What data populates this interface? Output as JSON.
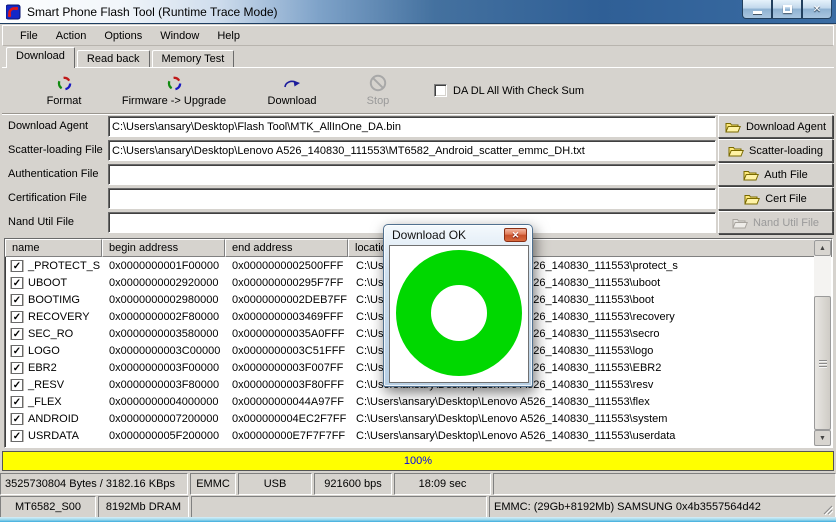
{
  "colors": {
    "ring_green": "#00d800",
    "progress_yellow": "#ffff00",
    "progress_text_blue": "#0000ee",
    "titlebar_blue": "#3a6ca3"
  },
  "window": {
    "title": "Smart Phone Flash Tool (Runtime Trace Mode)"
  },
  "menu": {
    "items": [
      "File",
      "Action",
      "Options",
      "Window",
      "Help"
    ]
  },
  "tabs": {
    "download": "Download",
    "readback": "Read back",
    "memorytest": "Memory Test"
  },
  "toolbar": {
    "format": "Format",
    "firmware_upgrade": "Firmware -> Upgrade",
    "download": "Download",
    "stop": "Stop",
    "da_dl_checksum": "DA DL All With Check Sum"
  },
  "files": {
    "rows": [
      {
        "label": "Download Agent",
        "value": "C:\\Users\\ansary\\Desktop\\Flash Tool\\MTK_AllInOne_DA.bin",
        "button": "Download Agent"
      },
      {
        "label": "Scatter-loading File",
        "value": "C:\\Users\\ansary\\Desktop\\Lenovo A526_140830_111553\\MT6582_Android_scatter_emmc_DH.txt",
        "button": "Scatter-loading"
      },
      {
        "label": "Authentication File",
        "value": "",
        "button": "Auth File"
      },
      {
        "label": "Certification File",
        "value": "",
        "button": "Cert File"
      },
      {
        "label": "Nand Util File",
        "value": "",
        "button": "Nand Util File"
      }
    ]
  },
  "table": {
    "columns": {
      "name": "name",
      "begin": "begin address",
      "end": "end address",
      "location": "location"
    },
    "rows": [
      {
        "name": "_PROTECT_S",
        "begin": "0x0000000001F00000",
        "end": "0x0000000002500FFF",
        "location": "C:\\Users\\ansary\\Desktop\\Lenovo A526_140830_111553\\protect_s"
      },
      {
        "name": "UBOOT",
        "begin": "0x0000000002920000",
        "end": "0x000000000295F7FF",
        "location": "C:\\Users\\ansary\\Desktop\\Lenovo A526_140830_111553\\uboot"
      },
      {
        "name": "BOOTIMG",
        "begin": "0x0000000002980000",
        "end": "0x0000000002DEB7FF",
        "location": "C:\\Users\\ansary\\Desktop\\Lenovo A526_140830_111553\\boot"
      },
      {
        "name": "RECOVERY",
        "begin": "0x0000000002F80000",
        "end": "0x0000000003469FFF",
        "location": "C:\\Users\\ansary\\Desktop\\Lenovo A526_140830_111553\\recovery"
      },
      {
        "name": "SEC_RO",
        "begin": "0x0000000003580000",
        "end": "0x00000000035A0FFF",
        "location": "C:\\Users\\ansary\\Desktop\\Lenovo A526_140830_111553\\secro"
      },
      {
        "name": "LOGO",
        "begin": "0x0000000003C00000",
        "end": "0x0000000003C51FFF",
        "location": "C:\\Users\\ansary\\Desktop\\Lenovo A526_140830_111553\\logo"
      },
      {
        "name": "EBR2",
        "begin": "0x0000000003F00000",
        "end": "0x0000000003F007FF",
        "location": "C:\\Users\\ansary\\Desktop\\Lenovo A526_140830_111553\\EBR2"
      },
      {
        "name": "_RESV",
        "begin": "0x0000000003F80000",
        "end": "0x0000000003F80FFF",
        "location": "C:\\Users\\ansary\\Desktop\\Lenovo A526_140830_111553\\resv"
      },
      {
        "name": "_FLEX",
        "begin": "0x0000000004000000",
        "end": "0x00000000044A97FF",
        "location": "C:\\Users\\ansary\\Desktop\\Lenovo A526_140830_111553\\flex"
      },
      {
        "name": "ANDROID",
        "begin": "0x0000000007200000",
        "end": "0x000000004EC2F7FF",
        "location": "C:\\Users\\ansary\\Desktop\\Lenovo A526_140830_111553\\system"
      },
      {
        "name": "USRDATA",
        "begin": "0x000000005F200000",
        "end": "0x00000000E7F7F7FF",
        "location": "C:\\Users\\ansary\\Desktop\\Lenovo A526_140830_111553\\userdata"
      }
    ]
  },
  "dialog": {
    "title": "Download OK",
    "close": "x"
  },
  "progress": {
    "percent": "100%"
  },
  "status": {
    "row1": [
      "3525730804 Bytes / 3182.16 KBps",
      "EMMC",
      "USB",
      "921600 bps",
      "18:09 sec",
      ""
    ],
    "row2": [
      "MT6582_S00",
      "8192Mb DRAM",
      "",
      "EMMC: (29Gb+8192Mb) SAMSUNG 0x4b3557564d42"
    ]
  }
}
